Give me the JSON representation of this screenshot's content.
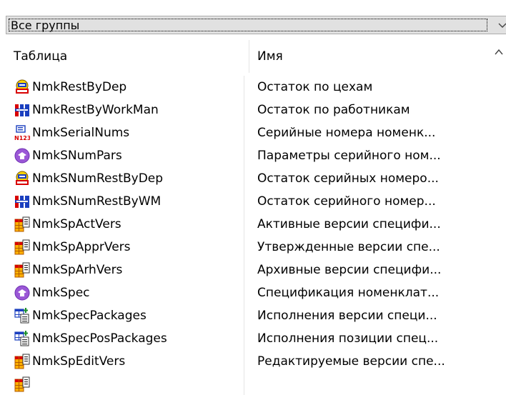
{
  "group_select": {
    "value": "Все группы"
  },
  "columns": {
    "table": "Таблица",
    "name": "Имя"
  },
  "rows": [
    {
      "table": "NmkRestByDep",
      "name": "Остаток по цехам",
      "icon": "storage-icon"
    },
    {
      "table": "NmkRestByWorkMan",
      "name": "Остаток по работникам",
      "icon": "register-icon"
    },
    {
      "table": "NmkSerialNums",
      "name": "Серийные номера номенк...",
      "icon": "serial-number-icon"
    },
    {
      "table": "NmkSNumPars",
      "name": "Параметры серийного ном...",
      "icon": "parameters-icon"
    },
    {
      "table": "NmkSNumRestByDep",
      "name": "Остаток серийных номеро...",
      "icon": "storage-icon"
    },
    {
      "table": "NmkSNumRestByWM",
      "name": "Остаток серийного номер...",
      "icon": "register-icon"
    },
    {
      "table": "NmkSpActVers",
      "name": "Активные версии специфи...",
      "icon": "table-icon"
    },
    {
      "table": "NmkSpApprVers",
      "name": "Утвержденные версии спе...",
      "icon": "table-icon"
    },
    {
      "table": "NmkSpArhVers",
      "name": "Архивные версии специфи...",
      "icon": "table-icon"
    },
    {
      "table": "NmkSpec",
      "name": "Спецификация номенклат...",
      "icon": "parameters-icon"
    },
    {
      "table": "NmkSpecPackages",
      "name": "Исполнения версии специ...",
      "icon": "package-icon"
    },
    {
      "table": "NmkSpecPosPackages",
      "name": "Исполнения позиции спец...",
      "icon": "package-icon"
    },
    {
      "table": "NmkSpEditVers",
      "name": "Редактируемые версии спе...",
      "icon": "table-icon"
    },
    {
      "table": "",
      "name": "",
      "icon": "table-icon"
    }
  ],
  "colors": {
    "selection_border": "#000000",
    "grid_line": "#e5e5e5",
    "combo_bg": "#e1e1e1"
  }
}
